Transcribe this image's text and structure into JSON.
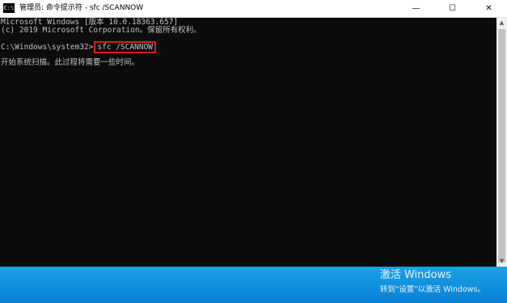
{
  "window": {
    "title": "管理员: 命令提示符 - sfc  /SCANNOW",
    "app_icon_text": "C:\\",
    "controls": {
      "minimize": "—",
      "maximize": "☐",
      "close": "✕"
    }
  },
  "console": {
    "line1": "Microsoft Windows [版本 10.0.18363.657]",
    "line2": "(c) 2019 Microsoft Corporation。保留所有权利。",
    "prompt": "C:\\Windows\\system32>",
    "command": "sfc /SCANNOW",
    "output": "开始系统扫描。此过程将需要一些时间。"
  },
  "scrollbar": {
    "up_arrow": "▲",
    "down_arrow": "▼"
  },
  "activation_watermark": {
    "title": "激活 Windows",
    "subtitle": "转到\"设置\"以激活 Windows。"
  },
  "colors": {
    "console_background": "#0c0c0c",
    "console_text": "#c0c0c0",
    "highlight_box": "#e0191f",
    "taskbar": "#0a8ad8"
  }
}
